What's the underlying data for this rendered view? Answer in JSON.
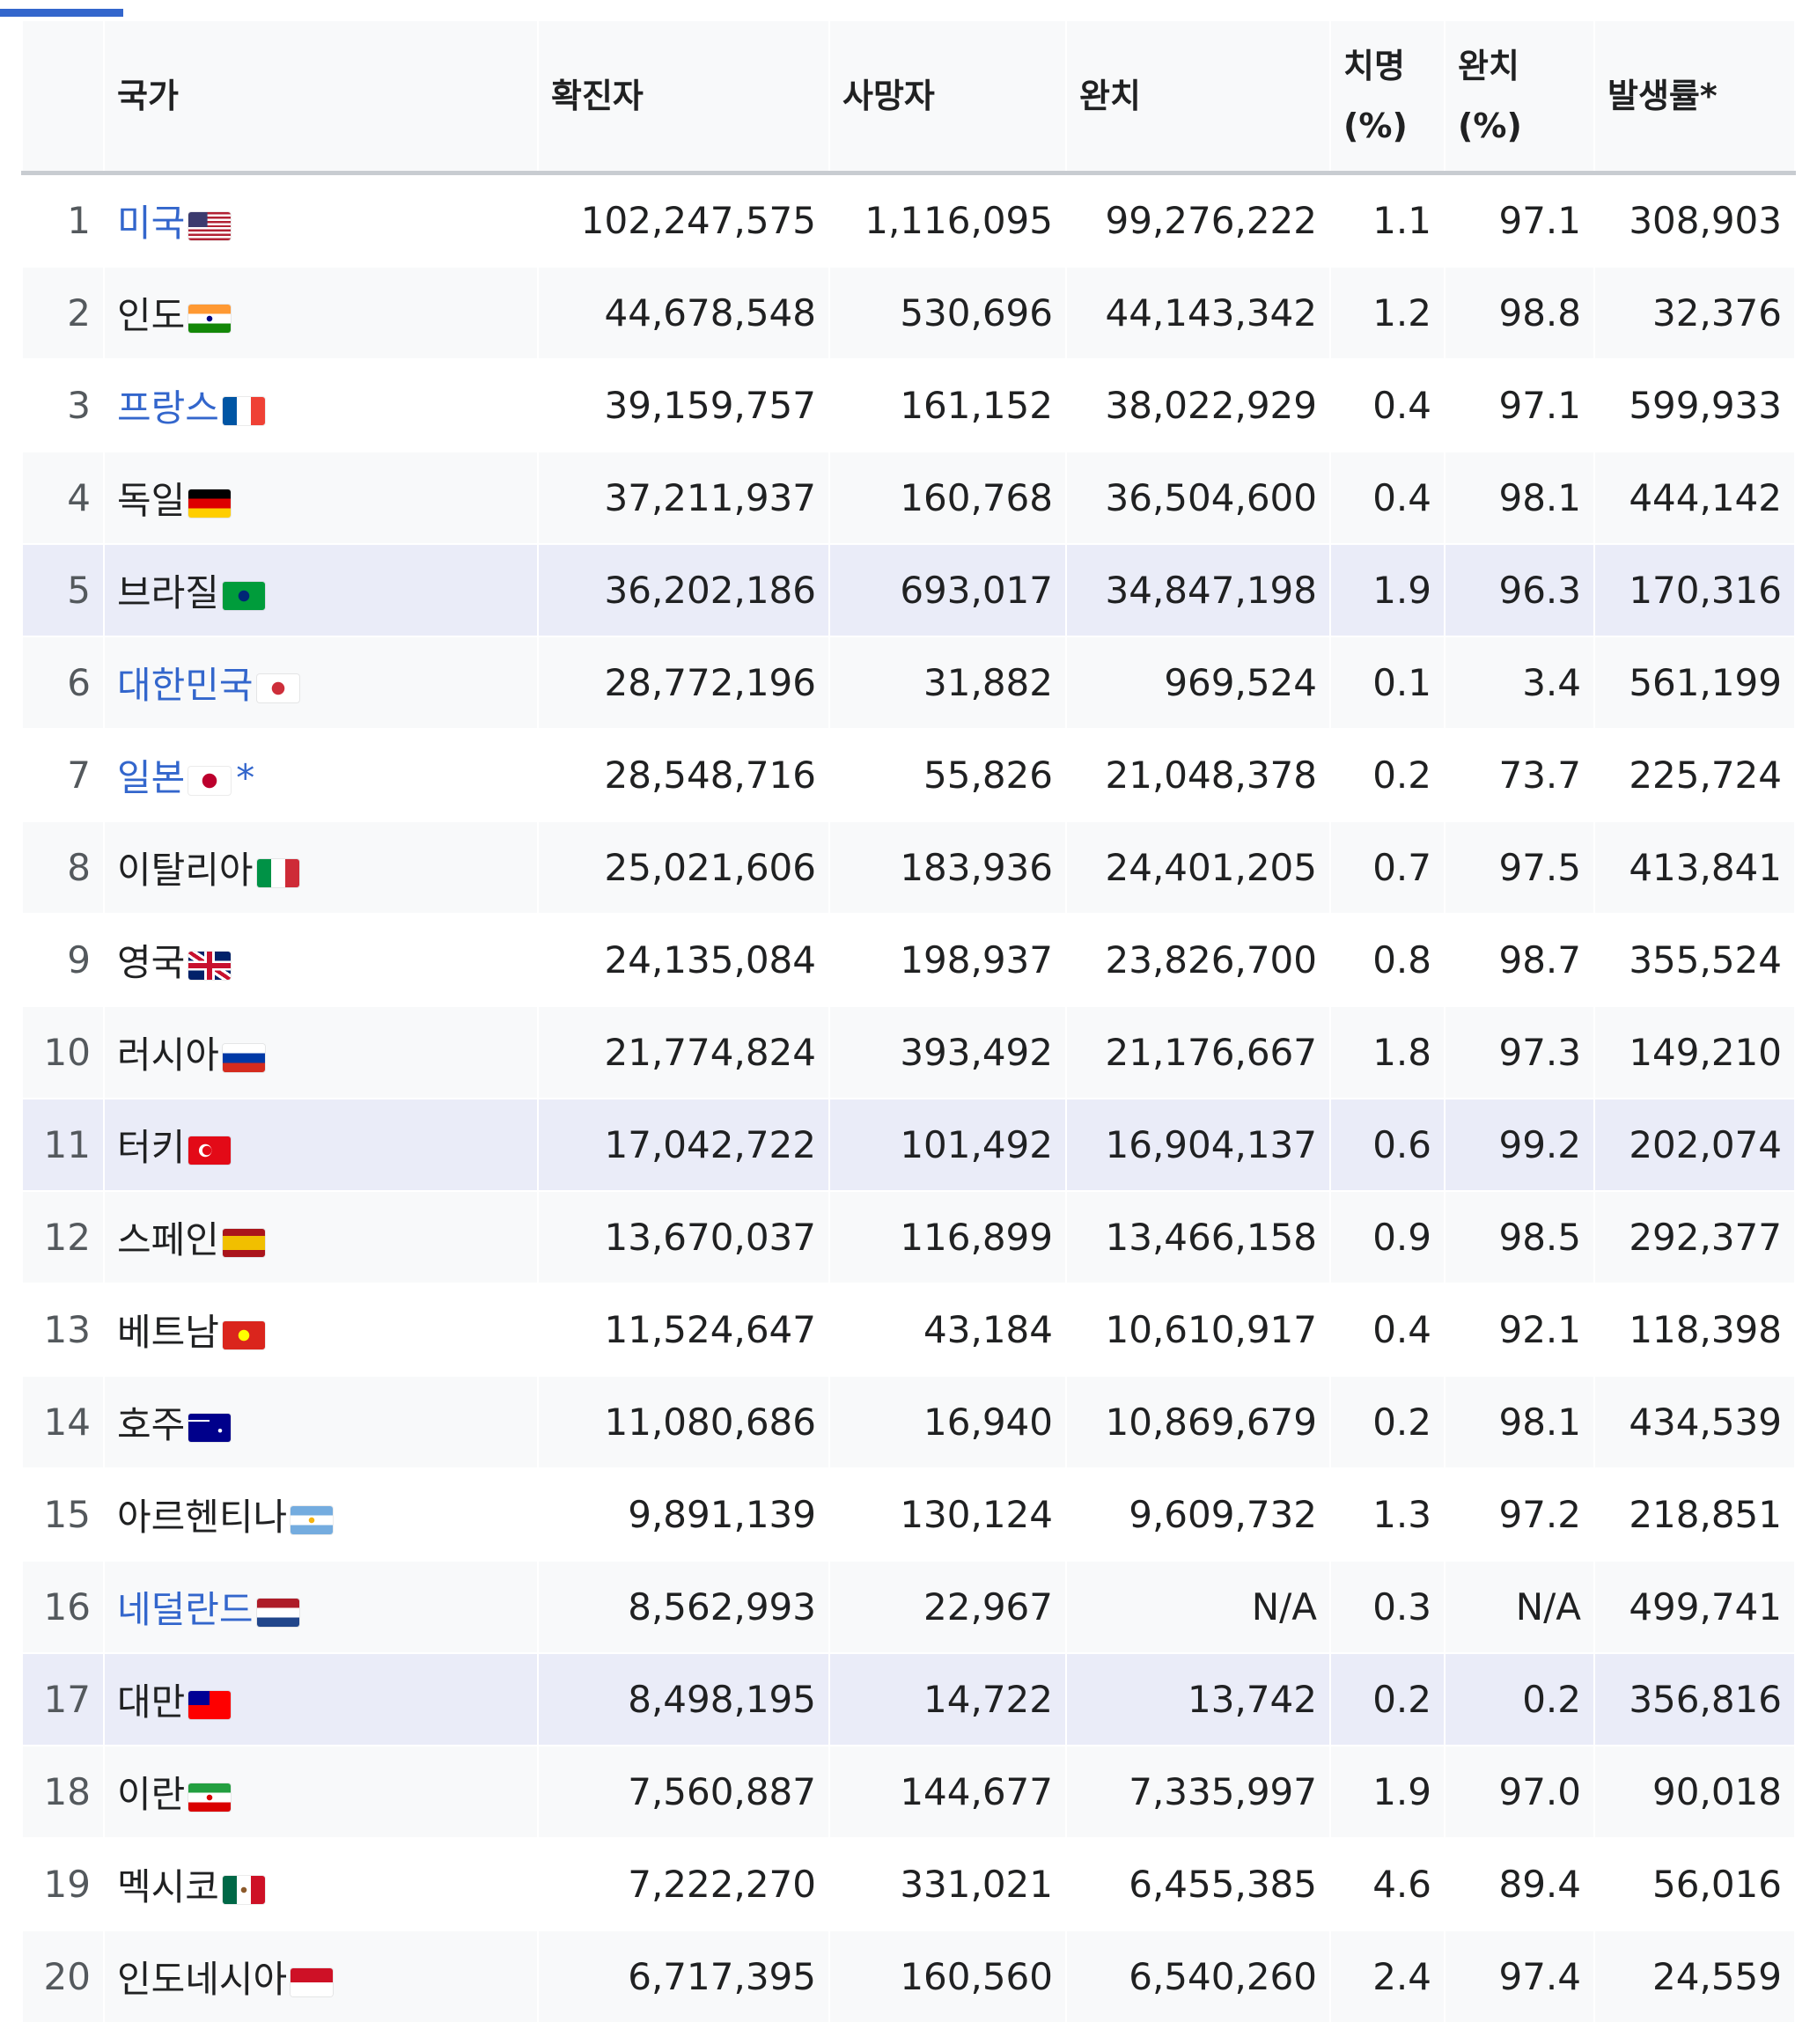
{
  "headers": {
    "rank": "",
    "country": "국가",
    "confirmed": "확진자",
    "deaths": "사망자",
    "recovered": "완치",
    "cfr_line1": "치명",
    "cfr_line2": "(%)",
    "recovery_line1": "완치",
    "recovery_line2": "(%)",
    "incidence": "발생률*"
  },
  "colors": {
    "accent": "#3366cc",
    "link": "#3366cc",
    "highlight_row": "#eaecf8",
    "stripe_row": "#f8f9fa"
  },
  "rows": [
    {
      "rank": "1",
      "country": "미국",
      "link": true,
      "flag": "flag-us",
      "confirmed": "102,247,575",
      "deaths": "1,116,095",
      "recovered": "99,276,222",
      "cfr": "1.1",
      "rr": "97.1",
      "incidence": "308,903"
    },
    {
      "rank": "2",
      "country": "인도",
      "link": false,
      "flag": "flag-in",
      "confirmed": "44,678,548",
      "deaths": "530,696",
      "recovered": "44,143,342",
      "cfr": "1.2",
      "rr": "98.8",
      "incidence": "32,376"
    },
    {
      "rank": "3",
      "country": "프랑스",
      "link": true,
      "flag": "flag-fr",
      "confirmed": "39,159,757",
      "deaths": "161,152",
      "recovered": "38,022,929",
      "cfr": "0.4",
      "rr": "97.1",
      "incidence": "599,933"
    },
    {
      "rank": "4",
      "country": "독일",
      "link": false,
      "flag": "flag-de",
      "confirmed": "37,211,937",
      "deaths": "160,768",
      "recovered": "36,504,600",
      "cfr": "0.4",
      "rr": "98.1",
      "incidence": "444,142"
    },
    {
      "rank": "5",
      "country": "브라질",
      "link": false,
      "flag": "flag-br",
      "confirmed": "36,202,186",
      "deaths": "693,017",
      "recovered": "34,847,198",
      "cfr": "1.9",
      "rr": "96.3",
      "incidence": "170,316",
      "highlight": true
    },
    {
      "rank": "6",
      "country": "대한민국",
      "link": true,
      "flag": "flag-kr",
      "confirmed": "28,772,196",
      "deaths": "31,882",
      "recovered": "969,524",
      "cfr": "0.1",
      "rr": "3.4",
      "incidence": "561,199"
    },
    {
      "rank": "7",
      "country": "일본",
      "link": true,
      "flag": "flag-jp",
      "star": "*",
      "confirmed": "28,548,716",
      "deaths": "55,826",
      "recovered": "21,048,378",
      "cfr": "0.2",
      "rr": "73.7",
      "incidence": "225,724"
    },
    {
      "rank": "8",
      "country": "이탈리아",
      "link": false,
      "flag": "flag-it",
      "confirmed": "25,021,606",
      "deaths": "183,936",
      "recovered": "24,401,205",
      "cfr": "0.7",
      "rr": "97.5",
      "incidence": "413,841"
    },
    {
      "rank": "9",
      "country": "영국",
      "link": false,
      "flag": "flag-gb",
      "confirmed": "24,135,084",
      "deaths": "198,937",
      "recovered": "23,826,700",
      "cfr": "0.8",
      "rr": "98.7",
      "incidence": "355,524"
    },
    {
      "rank": "10",
      "country": "러시아",
      "link": false,
      "flag": "flag-ru",
      "confirmed": "21,774,824",
      "deaths": "393,492",
      "recovered": "21,176,667",
      "cfr": "1.8",
      "rr": "97.3",
      "incidence": "149,210"
    },
    {
      "rank": "11",
      "country": "터키",
      "link": false,
      "flag": "flag-tr",
      "confirmed": "17,042,722",
      "deaths": "101,492",
      "recovered": "16,904,137",
      "cfr": "0.6",
      "rr": "99.2",
      "incidence": "202,074",
      "highlight": true
    },
    {
      "rank": "12",
      "country": "스페인",
      "link": false,
      "flag": "flag-es",
      "confirmed": "13,670,037",
      "deaths": "116,899",
      "recovered": "13,466,158",
      "cfr": "0.9",
      "rr": "98.5",
      "incidence": "292,377"
    },
    {
      "rank": "13",
      "country": "베트남",
      "link": false,
      "flag": "flag-vn",
      "confirmed": "11,524,647",
      "deaths": "43,184",
      "recovered": "10,610,917",
      "cfr": "0.4",
      "rr": "92.1",
      "incidence": "118,398"
    },
    {
      "rank": "14",
      "country": "호주",
      "link": false,
      "flag": "flag-au",
      "confirmed": "11,080,686",
      "deaths": "16,940",
      "recovered": "10,869,679",
      "cfr": "0.2",
      "rr": "98.1",
      "incidence": "434,539"
    },
    {
      "rank": "15",
      "country": "아르헨티나",
      "link": false,
      "flag": "flag-ar",
      "confirmed": "9,891,139",
      "deaths": "130,124",
      "recovered": "9,609,732",
      "cfr": "1.3",
      "rr": "97.2",
      "incidence": "218,851"
    },
    {
      "rank": "16",
      "country": "네덜란드",
      "link": true,
      "flag": "flag-nl",
      "confirmed": "8,562,993",
      "deaths": "22,967",
      "recovered": "N/A",
      "cfr": "0.3",
      "rr": "N/A",
      "incidence": "499,741"
    },
    {
      "rank": "17",
      "country": "대만",
      "link": false,
      "flag": "flag-tw",
      "confirmed": "8,498,195",
      "deaths": "14,722",
      "recovered": "13,742",
      "cfr": "0.2",
      "rr": "0.2",
      "incidence": "356,816",
      "highlight": true
    },
    {
      "rank": "18",
      "country": "이란",
      "link": false,
      "flag": "flag-ir",
      "confirmed": "7,560,887",
      "deaths": "144,677",
      "recovered": "7,335,997",
      "cfr": "1.9",
      "rr": "97.0",
      "incidence": "90,018"
    },
    {
      "rank": "19",
      "country": "멕시코",
      "link": false,
      "flag": "flag-mx",
      "confirmed": "7,222,270",
      "deaths": "331,021",
      "recovered": "6,455,385",
      "cfr": "4.6",
      "rr": "89.4",
      "incidence": "56,016"
    },
    {
      "rank": "20",
      "country": "인도네시아",
      "link": false,
      "flag": "flag-id",
      "confirmed": "6,717,395",
      "deaths": "160,560",
      "recovered": "6,540,260",
      "cfr": "2.4",
      "rr": "97.4",
      "incidence": "24,559"
    }
  ]
}
